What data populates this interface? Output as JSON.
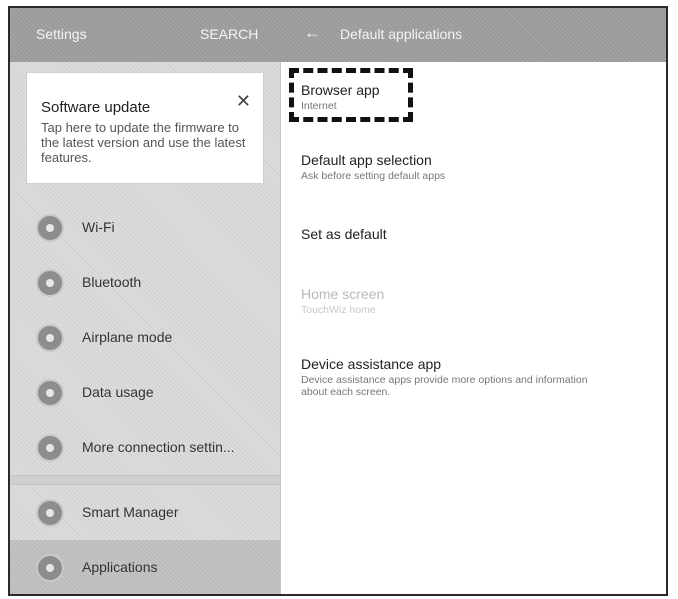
{
  "header": {
    "settings_title": "Settings",
    "search_label": "SEARCH",
    "back_glyph": "←",
    "page_title": "Default applications"
  },
  "software_update": {
    "title": "Software update",
    "body": "Tap here to update the firmware to the latest version and use the latest features.",
    "close_glyph": "✕"
  },
  "sidebar": {
    "items": [
      {
        "label": "Wi-Fi",
        "icon": "wifi-icon"
      },
      {
        "label": "Bluetooth",
        "icon": "bluetooth-icon"
      },
      {
        "label": "Airplane mode",
        "icon": "airplane-icon"
      },
      {
        "label": "Data usage",
        "icon": "data-usage-icon"
      },
      {
        "label": "More connection settin...",
        "icon": "more-connections-icon"
      }
    ],
    "bottom_items": [
      {
        "label": "Smart Manager",
        "icon": "smart-manager-icon"
      },
      {
        "label": "Applications",
        "icon": "applications-icon",
        "active": true
      }
    ]
  },
  "settings": {
    "browser_app": {
      "title": "Browser app",
      "sub": "Internet"
    },
    "default_selection": {
      "title": "Default app selection",
      "sub": "Ask before setting default apps"
    },
    "set_as_default": {
      "title": "Set as default"
    },
    "home_screen": {
      "title": "Home screen",
      "sub": "TouchWiz home"
    },
    "device_assistance": {
      "title": "Device assistance app",
      "sub": "Device assistance apps provide more options and information about each screen."
    }
  },
  "colors": {
    "topbar": "#9a9a9a",
    "sidebar": "#dcdcdc",
    "active_item": "#c3c3c3",
    "highlight_border": "#111111"
  }
}
